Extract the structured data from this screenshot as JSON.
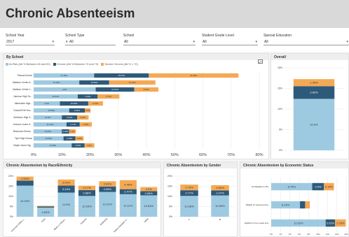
{
  "header": {
    "title": "Chronic Absenteeism"
  },
  "filters": [
    {
      "label": "School Year",
      "value": "2017"
    },
    {
      "label": "School Type",
      "value": "All"
    },
    {
      "label": "School",
      "value": "All"
    },
    {
      "label": "Student Grade Level",
      "value": "All"
    },
    {
      "label": "Special Education",
      "value": "All"
    }
  ],
  "colors": {
    "at_risk": "#9ecae1",
    "chronic": "#2e5a7a",
    "severe": "#f4a955",
    "header_bg": "#d9d9d9"
  },
  "by_school": {
    "title": "By School",
    "legend": [
      "At-Risk (Att % Between 80 and 90)",
      "Chronic (Att % Between 70 and 79)",
      "Severe Chronic (Att % < 70)"
    ],
    "expand_icon": "expand-icon",
    "chart_data": {
      "type": "bar",
      "orientation": "horizontal",
      "stacked": true,
      "categories": [
        "Pessoa School",
        "Madison Center A...",
        "Madison Center 1...",
        "Harrison High Sc...",
        "Alternative High...",
        "Donald Prell Sou...",
        "Sarribonn High S...",
        "Johnson Junior H...",
        "Birchmore Eleme...",
        "Tyler High School",
        "Maple Junior Hig..."
      ],
      "series": [
        {
          "name": "At-Risk (Att % Between 80 and 90)",
          "values": [
            21.45,
            16.18,
            22.0,
            15.64,
            9.3,
            12.59,
            10.0,
            11.64,
            10.0,
            10.59,
            13.48
          ],
          "labels": [
            "21.45%",
            "16.18%",
            "22%",
            "15.64%",
            "9.3%",
            "12.59%",
            "10.0%",
            "11.64%",
            "10.00%",
            "10.59%",
            "13.48%"
          ]
        },
        {
          "name": "Chronic (Att % Between 70 and 79)",
          "values": [
            19.37,
            10.59,
            13.67,
            7.04,
            10.06,
            5.55,
            5.43,
            4.71,
            2.63,
            4.19,
            4.53
          ],
          "labels": [
            "19.37%",
            "10.59%",
            "13.67%",
            "7.04%",
            "10.06%",
            "5.55%",
            "5.43%",
            "4.71%",
            "2.63%",
            "4.19%",
            "4.53%"
          ]
        },
        {
          "name": "Severe Chronic (Att % < 70)",
          "values": [
            31.8,
            16.41,
            8.56,
            7.72,
            5.23,
            2.0,
            4.06,
            4.29,
            2.3,
            2.93,
            3.5
          ],
          "labels": [
            "31.80%",
            "16.41%",
            "8.56%",
            "7.72%",
            "5.23%",
            "2.00%",
            "4.06%",
            "4.29%",
            "2.3%",
            "2.93%",
            "3.5%"
          ]
        }
      ],
      "xlim": [
        0,
        80
      ],
      "xticks": [
        "0%",
        "10%",
        "20%",
        "30%",
        "40%",
        "50%",
        "60%",
        "70%",
        "80%"
      ]
    }
  },
  "overall": {
    "title": "Overall",
    "chart_data": {
      "type": "bar",
      "stacked": true,
      "categories": [
        "Overall"
      ],
      "series": [
        {
          "name": "At-Risk",
          "values": [
            10.6
          ],
          "labels": [
            "10.6%"
          ]
        },
        {
          "name": "Chronic",
          "values": [
            2.62
          ],
          "labels": [
            "2.62%"
          ]
        },
        {
          "name": "Severe Chronic",
          "values": [
            1.45
          ],
          "labels": [
            "1.45%"
          ]
        }
      ],
      "ylim": [
        0,
        17
      ],
      "yticks": [
        "0%",
        "5%",
        "10%",
        "15%",
        "18%"
      ]
    }
  },
  "by_race": {
    "title": "Chronic Absenteeism by Race/Ethnicity",
    "chart_data": {
      "type": "bar",
      "stacked": true,
      "categories": [
        "American Indian o...",
        "Asian",
        "Black or African...",
        "Hispanic",
        "Multiracial",
        "Native Hawaiian or...",
        "White"
      ],
      "series": [
        {
          "name": "At-Risk",
          "values": [
            15.33,
            4.5,
            11.9,
            10.25,
            12.21,
            11.11,
            10.54
          ],
          "labels": [
            "15.33%",
            "4.50%",
            "11.9%",
            "10.25%",
            "12.21%",
            "11.11%",
            "10.54%"
          ]
        },
        {
          "name": "Chronic",
          "values": [
            2.5,
            0.6,
            3.44,
            2.88,
            2.69,
            2.47,
            2.06
          ],
          "labels": [
            "",
            "",
            "3.44%",
            "2.88%",
            "2.69%",
            "2.47%",
            "2.06%"
          ]
        },
        {
          "name": "Severe Chronic",
          "values": [
            1.94,
            0.3,
            3.01,
            2.17,
            2.61,
            4.46,
            2.0
          ],
          "labels": [
            "1.94%",
            "",
            "3.01%",
            "2.17%",
            "2.61%",
            "4.46%",
            "2.0%"
          ]
        }
      ],
      "ylim": [
        0,
        20
      ],
      "yticks": [
        "0%",
        "5%",
        "10%",
        "15%",
        "20%"
      ]
    }
  },
  "by_gender": {
    "title": "Chronic Absenteeism by Gender",
    "chart_data": {
      "type": "bar",
      "stacked": true,
      "categories": [
        "F",
        "M"
      ],
      "series": [
        {
          "name": "At-Risk",
          "values": [
            10.28,
            10.5
          ],
          "labels": [
            "10.28%",
            "10.50%"
          ]
        },
        {
          "name": "Chronic",
          "values": [
            2.77,
            2.47
          ],
          "labels": [
            "2.77%",
            "2.47%"
          ]
        },
        {
          "name": "Severe Chronic",
          "values": [
            2.79,
            2.6
          ],
          "labels": [
            "2.79%",
            "2.60%"
          ]
        }
      ],
      "ylim": [
        0,
        20
      ],
      "yticks": [
        "0%",
        "5%",
        "10%",
        "15%",
        "20%"
      ]
    }
  },
  "by_econ": {
    "title": "Chronic Absenteeism by Economic Status",
    "chart_data": {
      "type": "bar",
      "orientation": "horizontal",
      "stacked": true,
      "categories": [
        "Not Eligible for FR...",
        "Eligible for reduced price...",
        "Eligible for free meals and..."
      ],
      "series": [
        {
          "name": "At-Risk",
          "values": [
            8.75,
            6.14,
            11.62
          ],
          "labels": [
            "8.75%",
            "6.14%",
            "11.62%"
          ]
        },
        {
          "name": "Chronic",
          "values": [
            2.5,
            1.1,
            2.01
          ],
          "labels": [
            "2.5%",
            "",
            "2.01%"
          ]
        },
        {
          "name": "Severe Chronic",
          "values": [
            2.14,
            1.0,
            2.28
          ],
          "labels": [
            "2.14%",
            "",
            "2.28%"
          ]
        }
      ],
      "xlim": [
        0,
        16
      ],
      "xticks": [
        "0%",
        "2%",
        "4%",
        "6%",
        "8%",
        "10%",
        "12%",
        "14%",
        "16%"
      ]
    }
  }
}
